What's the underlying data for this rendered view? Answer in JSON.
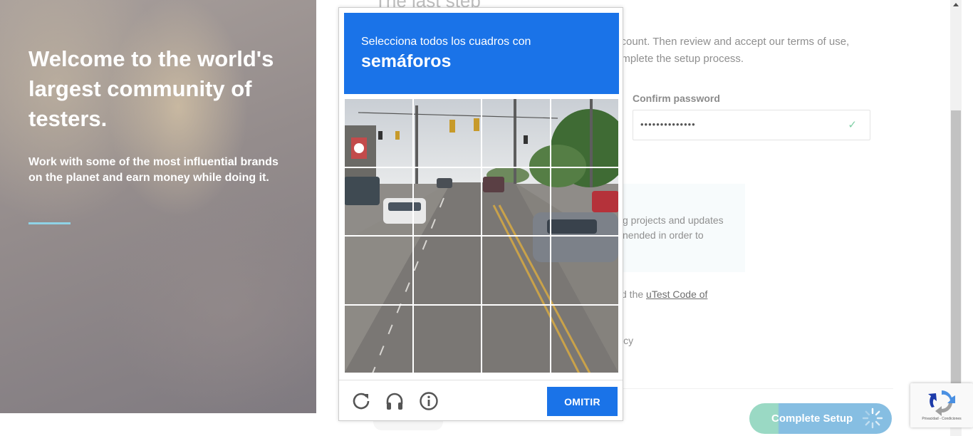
{
  "hero": {
    "title": "Welcome to the world's largest community of testers.",
    "subtitle": "Work with some of the most influential brands on the planet and earn money while doing it."
  },
  "form": {
    "title": "The last step",
    "intro": "ccount. Then review and accept our terms of use, omplete the setup process.",
    "confirm_password_label": "Confirm password",
    "confirm_password_value": "••••••••••••••",
    "note_text": "g projects and updates nended in order to",
    "code_prefix": "d the ",
    "code_link": "uTest Code of",
    "policy_text": "icy",
    "complete_button": "Complete Setup"
  },
  "captcha": {
    "instruction": "Selecciona todos los cuadros con",
    "keyword": "semáforos",
    "skip_button": "OMITIR",
    "icons": [
      "reload-icon",
      "audio-headphones-icon",
      "info-icon"
    ]
  },
  "recaptcha_badge": {
    "text": "Privacidad - Condiciones"
  },
  "colors": {
    "captcha_blue": "#1a73e8",
    "hero_accent": "#8fd3e6",
    "complete_button_green": "#9ad9c4",
    "complete_button_blue": "#86bee2"
  }
}
